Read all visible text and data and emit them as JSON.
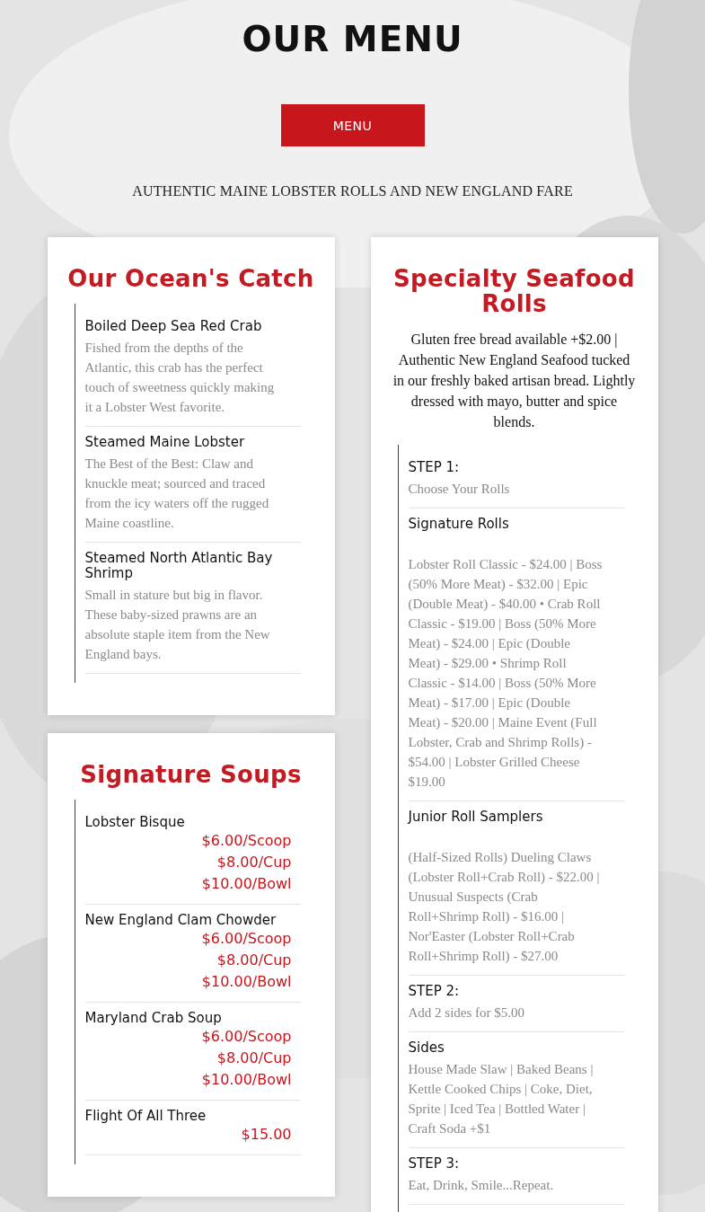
{
  "header": {
    "title": "OUR MENU",
    "menu_button": "MENU",
    "tagline": "AUTHENTIC MAINE LOBSTER ROLLS AND NEW ENGLAND FARE"
  },
  "background": {
    "kind": "picture"
  },
  "columns": [
    [
      {
        "title": "Our Ocean's Catch",
        "items": [
          {
            "kind": "plain",
            "name": "Boiled Deep Sea Red Crab",
            "description": "Fished from the depths of the Atlantic, this crab has the perfect touch of sweetness quickly making it a Lobster West favorite."
          },
          {
            "kind": "plain",
            "name": "Steamed Maine Lobster",
            "description": "The Best of the Best: Claw and knuckle meat; sourced and traced from the icy waters off the rugged Maine coastline."
          },
          {
            "kind": "plain",
            "name": "Steamed North Atlantic Bay Shrimp",
            "description": "Small in stature but big in flavor. These baby-sized prawns are an absolute staple item from the New England bays."
          }
        ]
      },
      {
        "title": "Signature Soups",
        "items": [
          {
            "kind": "priced",
            "name": "Lobster Bisque",
            "prices": [
              "$6.00/Scoop",
              "$8.00/Cup",
              "$10.00/Bowl"
            ]
          },
          {
            "kind": "priced",
            "name": "New England Clam Chowder",
            "prices": [
              "$6.00/Scoop",
              "$8.00/Cup",
              "$10.00/Bowl"
            ]
          },
          {
            "kind": "priced",
            "name": "Maryland Crab Soup",
            "prices": [
              "$6.00/Scoop",
              "$8.00/Cup",
              "$10.00/Bowl"
            ]
          },
          {
            "kind": "priced",
            "name": "Flight Of All Three",
            "prices": [
              "$15.00"
            ]
          }
        ]
      }
    ],
    [
      {
        "title": "Specialty Seafood Rolls",
        "intro": "Gluten free bread available +$2.00 | Authentic New England Seafood tucked in our freshly baked artisan bread. Lightly dressed with mayo, butter and spice blends.",
        "items": [
          {
            "kind": "plain",
            "name": "STEP 1:",
            "description": "Choose Your Rolls"
          },
          {
            "kind": "spaced",
            "name": "Signature Rolls",
            "description": "Lobster Roll Classic - $24.00 | Boss (50% More Meat) - $32.00 | Epic (Double Meat) - $40.00 • Crab Roll Classic - $19.00 | Boss (50% More Meat) - $24.00 | Epic (Double Meat) - $29.00 • Shrimp Roll Classic - $14.00 | Boss (50% More Meat) - $17.00 | Epic (Double Meat) - $20.00 | Maine Event (Full Lobster, Crab and Shrimp Rolls) - $54.00 | Lobster Grilled Cheese $19.00"
          },
          {
            "kind": "spaced",
            "name": "Junior Roll Samplers",
            "description": "(Half-Sized Rolls) Dueling Claws (Lobster Roll+Crab Roll) - $22.00 | Unusual Suspects (Crab Roll+Shrimp Roll) - $16.00 | Nor'Easter (Lobster Roll+Crab Roll+Shrimp Roll) - $27.00"
          },
          {
            "kind": "plain",
            "name": "STEP 2:",
            "description": "Add 2 sides for $5.00"
          },
          {
            "kind": "plain",
            "name": "Sides",
            "description": "House Made Slaw | Baked Beans | Kettle Cooked Chips | Coke, Diet, Sprite | Iced Tea | Bottled Water | Craft Soda +$1"
          },
          {
            "kind": "plain",
            "name": "STEP 3:",
            "description": "Eat, Drink, Smile...Repeat."
          }
        ]
      }
    ]
  ]
}
